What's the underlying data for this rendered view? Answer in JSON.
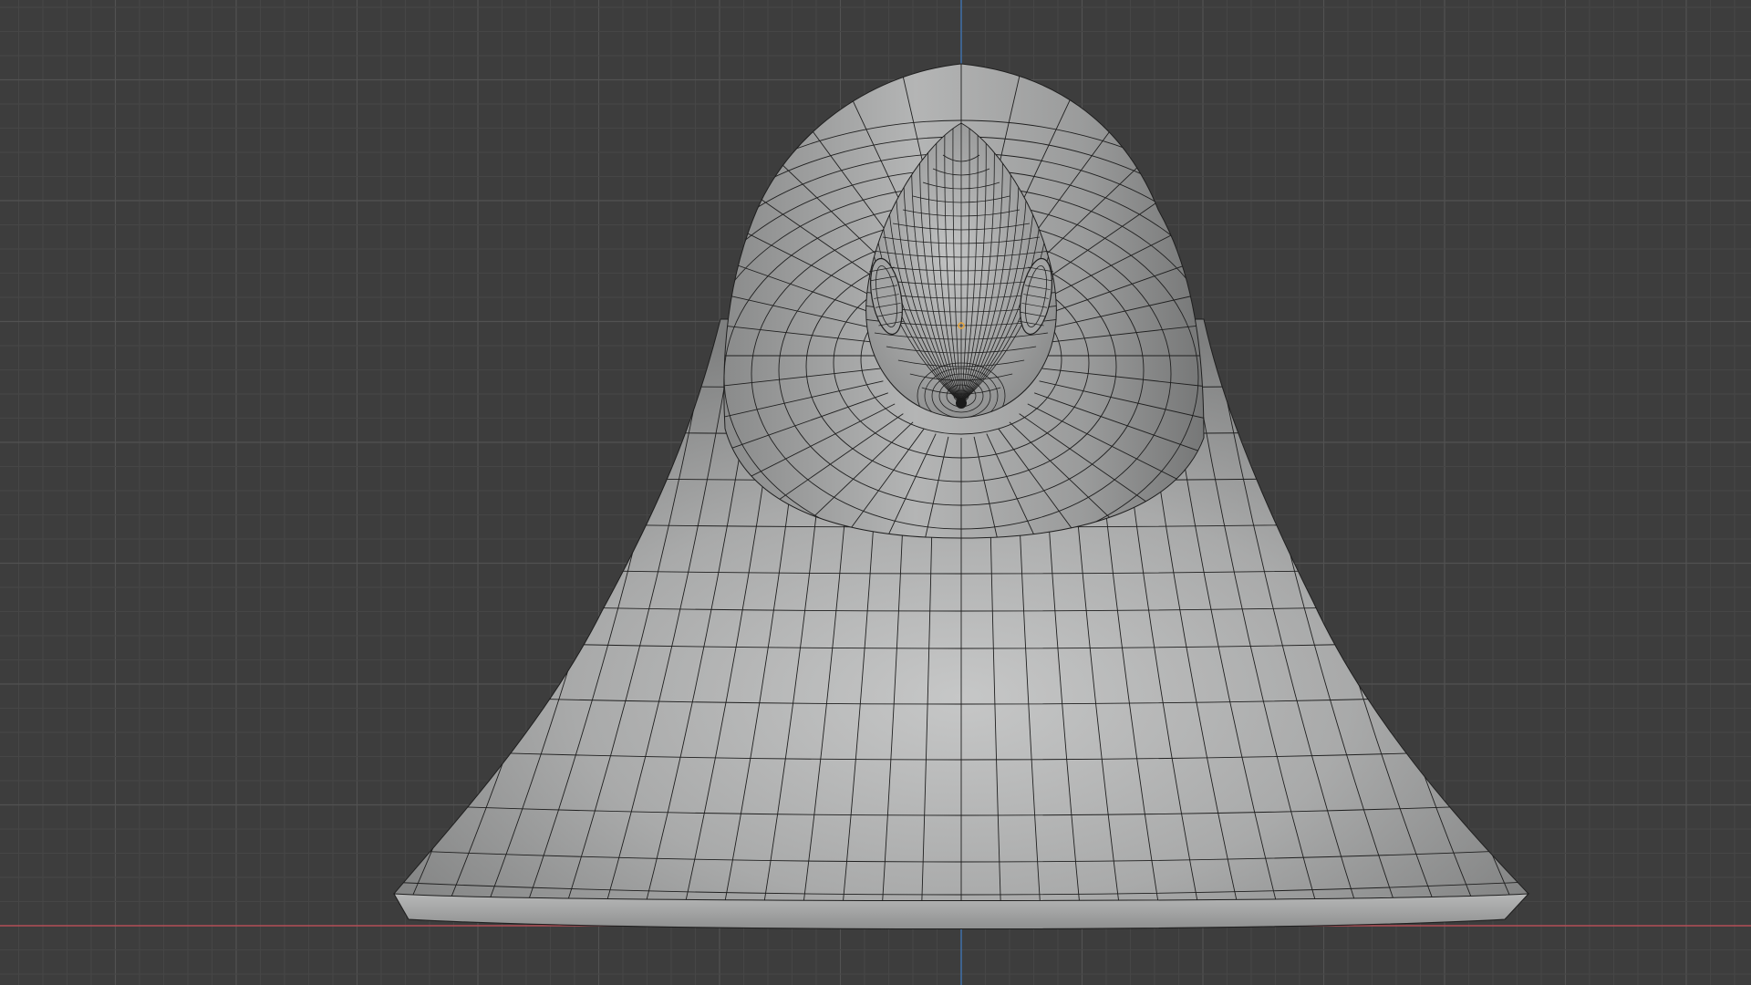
{
  "viewport": {
    "view": "front-orthographic",
    "mode": "edit-mode-wireframe-overlay",
    "background_color": "#3d3d3d",
    "grid_minor_color": "#464646",
    "grid_major_color": "#525252",
    "x_axis_color": "#b34d56",
    "z_axis_color": "#3f6fa8",
    "mesh_fill_color": "#9d9e9e",
    "mesh_highlight_color": "#c5c6c6",
    "mesh_shadow_color": "#7d7e7e",
    "wire_color": "#1f1f1f",
    "origin_color": "#e8a53a"
  },
  "object": {
    "shape": "bell-shaped body with pointed head",
    "has_eye_rings": true,
    "has_origin_marker": true
  }
}
